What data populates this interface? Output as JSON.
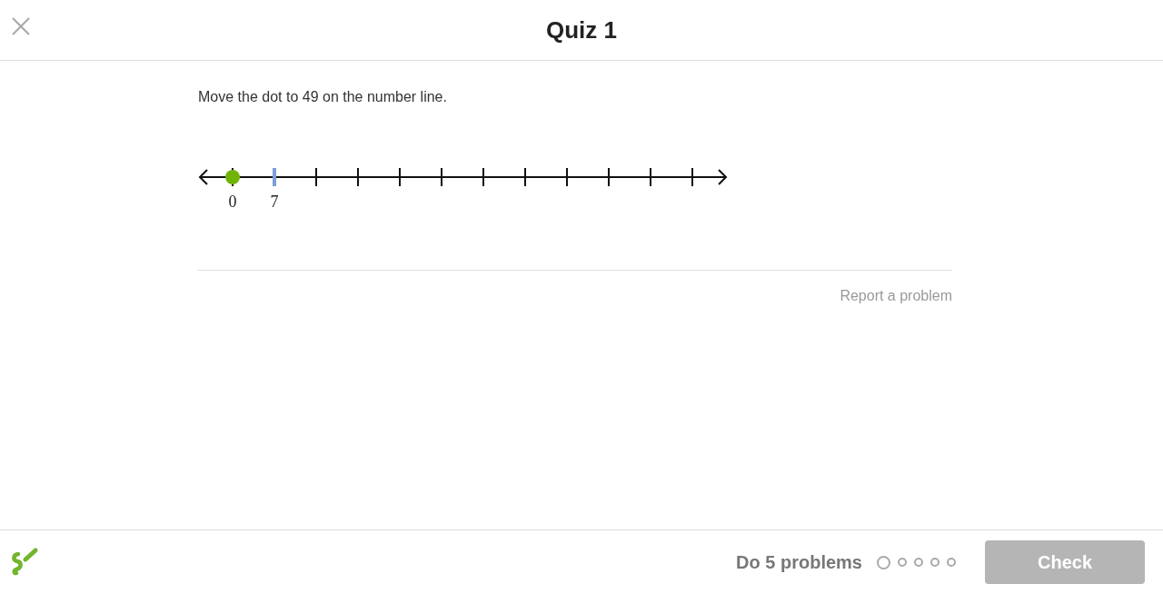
{
  "header": {
    "title": "Quiz 1"
  },
  "question": {
    "text": "Move the dot to 49 on the number line."
  },
  "number_line": {
    "ticks": [
      {
        "label": "0",
        "highlighted": false,
        "has_dot": true
      },
      {
        "label": "7",
        "highlighted": true,
        "has_dot": false
      },
      {
        "highlighted": false,
        "has_dot": false
      },
      {
        "highlighted": false,
        "has_dot": false
      },
      {
        "highlighted": false,
        "has_dot": false
      },
      {
        "highlighted": false,
        "has_dot": false
      },
      {
        "highlighted": false,
        "has_dot": false
      },
      {
        "highlighted": false,
        "has_dot": false
      },
      {
        "highlighted": false,
        "has_dot": false
      },
      {
        "highlighted": false,
        "has_dot": false
      },
      {
        "highlighted": false,
        "has_dot": false
      },
      {
        "highlighted": false,
        "has_dot": false
      }
    ]
  },
  "report_link": "Report a problem",
  "footer": {
    "progress_text": "Do 5 problems",
    "progress": [
      {
        "selected": true
      },
      {
        "selected": false
      },
      {
        "selected": false
      },
      {
        "selected": false
      },
      {
        "selected": false
      }
    ],
    "check_button": {
      "label": "Check",
      "disabled": true
    }
  }
}
